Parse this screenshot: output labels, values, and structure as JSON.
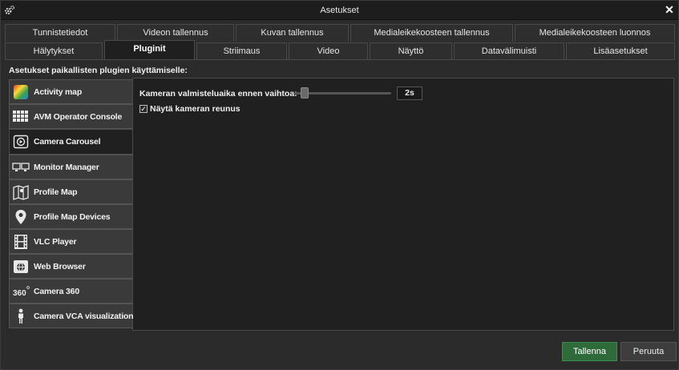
{
  "window": {
    "title": "Asetukset",
    "close_glyph": "✕"
  },
  "tabs_row1": [
    {
      "label": "Tunnistetiedot"
    },
    {
      "label": "Videon tallennus"
    },
    {
      "label": "Kuvan tallennus"
    },
    {
      "label": "Medialeikekoosteen tallennus"
    },
    {
      "label": "Medialeikekoosteen luonnos"
    }
  ],
  "tabs_row2": [
    {
      "label": "Hälytykset"
    },
    {
      "label": "Pluginit",
      "active": true
    },
    {
      "label": "Striimaus"
    },
    {
      "label": "Video"
    },
    {
      "label": "Näyttö"
    },
    {
      "label": "Datavälimuisti"
    },
    {
      "label": "Lisäasetukset"
    }
  ],
  "section": {
    "label": "Asetukset paikallisten plugien käyttämiselle:"
  },
  "plugins": [
    {
      "label": "Activity map",
      "icon": "activity-map-icon"
    },
    {
      "label": "AVM Operator Console",
      "icon": "grid-console-icon"
    },
    {
      "label": "Camera Carousel",
      "icon": "carousel-icon",
      "active": true
    },
    {
      "label": "Monitor Manager",
      "icon": "monitors-icon"
    },
    {
      "label": "Profile Map",
      "icon": "map-icon"
    },
    {
      "label": "Profile Map Devices",
      "icon": "map-pin-icon"
    },
    {
      "label": "VLC Player",
      "icon": "film-icon"
    },
    {
      "label": "Web Browser",
      "icon": "browser-icon"
    },
    {
      "label": "Camera 360",
      "icon": "camera-360-icon"
    },
    {
      "label": "Camera VCA visualization",
      "icon": "person-icon"
    }
  ],
  "settings": {
    "delay_label": "Kameran valmisteluaika ennen vaihtoa:",
    "delay_value": "2s",
    "delay_slider_fraction": 0.08,
    "border_label": "Näytä kameran reunus",
    "border_checked": true,
    "check_glyph": "✓"
  },
  "buttons": {
    "save": "Tallenna",
    "cancel": "Peruuta"
  },
  "colors": {
    "save": "#2f6b3a",
    "background": "#2b2b2b",
    "panel": "#202020"
  }
}
